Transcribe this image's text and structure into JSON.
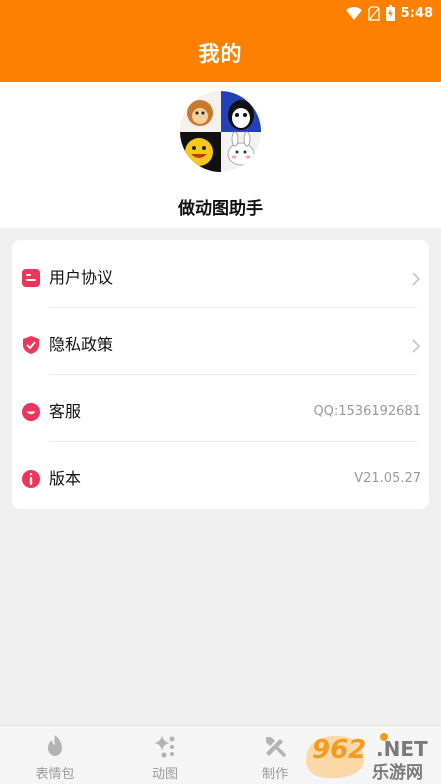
{
  "status_bar": {
    "time": "5:48",
    "icons": [
      "wifi-icon",
      "no-sim-icon",
      "battery-charging-icon"
    ]
  },
  "header": {
    "title": "我的"
  },
  "profile": {
    "app_name": "做动图助手"
  },
  "menu": {
    "items": [
      {
        "label": "用户协议",
        "value": "",
        "icon": "document-icon",
        "has_chevron": true
      },
      {
        "label": "隐私政策",
        "value": "",
        "icon": "shield-check-icon",
        "has_chevron": true
      },
      {
        "label": "客服",
        "value": "QQ:1536192681",
        "icon": "smile-icon",
        "has_chevron": false
      },
      {
        "label": "版本",
        "value": "V21.05.27",
        "icon": "info-icon",
        "has_chevron": false
      }
    ]
  },
  "tab_bar": {
    "tabs": [
      {
        "label": "表情包",
        "icon": "flame-icon"
      },
      {
        "label": "动图",
        "icon": "sparkle-icon"
      },
      {
        "label": "制作",
        "icon": "tools-icon"
      }
    ]
  },
  "watermark": {
    "logo_text": "962.NET",
    "sub_text": "乐游网"
  },
  "colors": {
    "accent": "#ff7f00",
    "icon_red": "#f0345a",
    "background": "#efefef",
    "muted": "#999999"
  }
}
